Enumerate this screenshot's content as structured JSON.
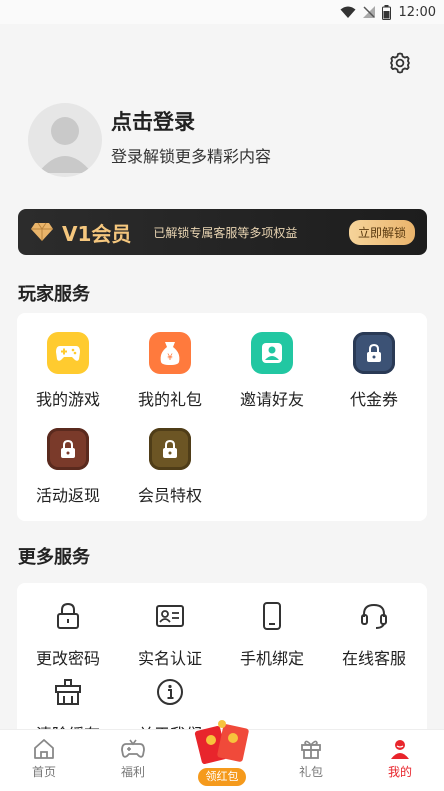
{
  "status_bar": {
    "time": "12:00"
  },
  "profile": {
    "title": "点击登录",
    "subtitle": "登录解锁更多精彩内容"
  },
  "vip": {
    "title": "V1会员",
    "desc": "已解锁专属客服等多项权益",
    "button": "立即解锁"
  },
  "player_services": {
    "title": "玩家服务",
    "items": [
      {
        "label": "我的游戏",
        "icon": "gamepad-icon",
        "color": "#ffcb2f"
      },
      {
        "label": "我的礼包",
        "icon": "gift-bag-icon",
        "color": "#ff7a3d"
      },
      {
        "label": "邀请好友",
        "icon": "invite-icon",
        "color": "#22c7a2"
      },
      {
        "label": "代金券",
        "icon": "lock-icon",
        "color": "#3c5275"
      },
      {
        "label": "活动返现",
        "icon": "lock-icon",
        "color": "#7a3a2a"
      },
      {
        "label": "会员特权",
        "icon": "lock-icon",
        "color": "#6c5524"
      }
    ]
  },
  "more_services": {
    "title": "更多服务",
    "items": [
      {
        "label": "更改密码",
        "icon": "lock-outline-icon"
      },
      {
        "label": "实名认证",
        "icon": "id-card-icon"
      },
      {
        "label": "手机绑定",
        "icon": "phone-icon"
      },
      {
        "label": "在线客服",
        "icon": "headset-icon"
      },
      {
        "label": "清除缓存",
        "icon": "broom-icon"
      },
      {
        "label": "关于我们",
        "icon": "info-icon"
      }
    ]
  },
  "tabbar": {
    "home": "首页",
    "welfare": "福利",
    "redpacket": "领红包",
    "gift": "礼包",
    "mine": "我的"
  },
  "colors": {
    "active": "#e8252c",
    "vip_gold": "#f5c77e"
  }
}
